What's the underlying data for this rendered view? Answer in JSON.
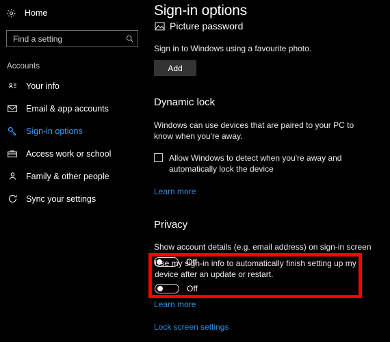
{
  "sidebar": {
    "home": {
      "label": "Home",
      "icon": "gear-icon"
    },
    "search": {
      "placeholder": "Find a setting",
      "value": "",
      "icon": "search-icon"
    },
    "group_title": "Accounts",
    "items": [
      {
        "label": "Your info",
        "icon": "contact-card-icon",
        "active": false
      },
      {
        "label": "Email & app accounts",
        "icon": "envelope-icon",
        "active": false
      },
      {
        "label": "Sign-in options",
        "icon": "key-icon",
        "active": true
      },
      {
        "label": "Access work or school",
        "icon": "briefcase-icon",
        "active": false
      },
      {
        "label": "Family & other people",
        "icon": "person-icon",
        "active": false
      },
      {
        "label": "Sync your settings",
        "icon": "sync-icon",
        "active": false
      }
    ]
  },
  "main": {
    "page_title": "Sign-in options",
    "picture_password": {
      "heading": "Picture password",
      "icon": "picture-icon",
      "description": "Sign in to Windows using a favourite photo.",
      "add_button": "Add"
    },
    "dynamic_lock": {
      "heading": "Dynamic lock",
      "description": "Windows can use devices that are paired to your PC to know when you're away.",
      "checkbox_label": "Allow Windows to detect when you're away and automatically lock the device",
      "checkbox_checked": false,
      "learn_more": "Learn more"
    },
    "privacy": {
      "heading": "Privacy",
      "account_details": {
        "label": "Show account details (e.g. email address) on sign-in screen",
        "toggle_state": "Off",
        "toggle_on": false
      },
      "signin_info": {
        "label": "Use my sign-in info to automatically finish setting up my device after an update or restart.",
        "toggle_state": "Off",
        "toggle_on": false,
        "highlighted": true
      },
      "learn_more": "Learn more",
      "lock_screen_settings": "Lock screen settings"
    }
  },
  "colors": {
    "background": "#000000",
    "accent_link": "#2f8fe3",
    "active_nav": "#3b9dff",
    "highlight_border": "#ff0000",
    "button_face": "#333333"
  }
}
